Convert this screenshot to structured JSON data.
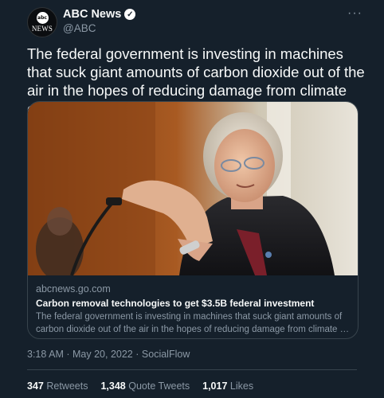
{
  "author": {
    "name": "ABC News",
    "handle": "@ABC",
    "avatar": {
      "mark": "abc",
      "word": "NEWS"
    },
    "verified_icon": "verified-badge-icon"
  },
  "more_icon": "···",
  "tweet": {
    "text": "The federal government is investing in machines that suck giant amounts of carbon dioxide out of the air in the hopes of reducing damage from climate change."
  },
  "card": {
    "domain": "abcnews.go.com",
    "title": "Carbon removal technologies to get $3.5B federal investment",
    "description": "The federal government is investing in machines that suck giant amounts of carbon dioxide out of the air in the hopes of reducing damage from climate …"
  },
  "meta": {
    "time": "3:18 AM",
    "sep": "·",
    "date": "May 20, 2022",
    "source": "SocialFlow"
  },
  "stats": {
    "retweets": {
      "count": "347",
      "label": "Retweets"
    },
    "quotes": {
      "count": "1,348",
      "label": "Quote Tweets"
    },
    "likes": {
      "count": "1,017",
      "label": "Likes"
    }
  },
  "colors": {
    "background": "#15202b",
    "text": "#f7f9f9",
    "muted": "#8b98a5",
    "border": "#38444d"
  }
}
